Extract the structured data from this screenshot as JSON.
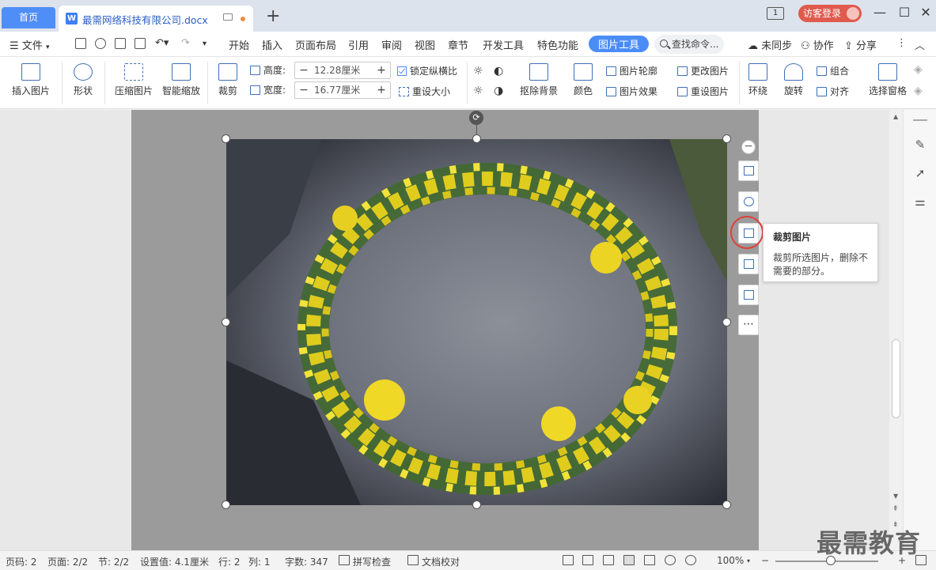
{
  "titlebar": {
    "home_tab": "首页",
    "doc_tab": "最需网络科技有限公司.docx",
    "new_tab": "+",
    "page_indicator": "1",
    "login": "访客登录",
    "minimize": "—",
    "maximize": "☐",
    "close": "✕"
  },
  "menubar": {
    "file": "文件",
    "items": [
      "开始",
      "插入",
      "页面布局",
      "引用",
      "审阅",
      "视图",
      "章节",
      "开发工具",
      "特色功能"
    ],
    "active": "图片工具",
    "search": "查找命令...",
    "sync": "未同步",
    "collab": "协作",
    "share": "分享"
  },
  "ribbon": {
    "insert_pic": "插入图片",
    "shape": "形状",
    "compress": "压缩图片",
    "smart_zoom": "智能缩放",
    "crop": "裁剪",
    "height_label": "高度:",
    "height_value": "12.28厘米",
    "width_label": "宽度:",
    "width_value": "16.77厘米",
    "lock_ratio": "锁定纵横比",
    "reset_size": "重设大小",
    "remove_bg": "抠除背景",
    "color": "颜色",
    "outline": "图片轮廓",
    "effect": "图片效果",
    "change_pic": "更改图片",
    "reset_pic": "重设图片",
    "wrap": "环绕",
    "rotate": "旋转",
    "group": "组合",
    "align": "对齐",
    "select_pane": "选择窗格"
  },
  "tooltip": {
    "title": "裁剪图片",
    "body": "裁剪所选图片，删除不需要的部分。"
  },
  "statusbar": {
    "page_num": "页码: 2",
    "pages": "页面: 2/2",
    "section": "节: 2/2",
    "setting": "设置值: 4.1厘米",
    "row": "行: 2",
    "col": "列: 1",
    "words": "字数: 347",
    "spell": "拼写检查",
    "proof": "文档校对",
    "zoom": "100%"
  },
  "watermark": "最需教育",
  "colors": {
    "accent": "#4b8df8",
    "login": "#e05a4e",
    "highlight_ring": "#e0403a"
  }
}
